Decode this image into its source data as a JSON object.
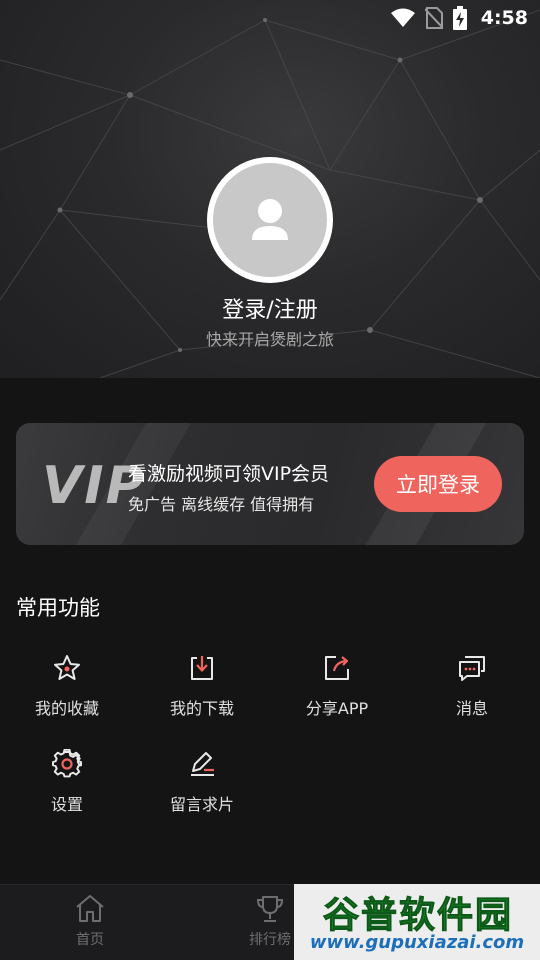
{
  "status_bar": {
    "time": "4:58",
    "icons": [
      "wifi-icon",
      "no-sim-icon",
      "battery-charging-icon"
    ]
  },
  "profile": {
    "login_title": "登录/注册",
    "login_subtitle": "快来开启煲剧之旅"
  },
  "vip": {
    "logo": "VIP",
    "title": "看激励视频可领VIP会员",
    "description": "免广告 离线缓存 值得拥有",
    "button_label": "立即登录",
    "button_color": "#f0645e"
  },
  "functions": {
    "section_title": "常用功能",
    "items": [
      {
        "label": "我的收藏",
        "icon": "star-icon"
      },
      {
        "label": "我的下载",
        "icon": "download-icon"
      },
      {
        "label": "分享APP",
        "icon": "share-icon"
      },
      {
        "label": "消息",
        "icon": "message-icon"
      },
      {
        "label": "设置",
        "icon": "settings-gear-icon"
      },
      {
        "label": "留言求片",
        "icon": "edit-pen-icon"
      }
    ]
  },
  "tabbar": {
    "tabs": [
      {
        "label": "首页",
        "icon": "home-icon"
      },
      {
        "label": "排行榜",
        "icon": "trophy-icon"
      }
    ]
  },
  "watermark": {
    "title": "谷普软件园",
    "url": "www.gupuxiazai.com"
  },
  "colors": {
    "accent": "#f0645e",
    "background": "#141414",
    "card": "#2e2e30"
  }
}
